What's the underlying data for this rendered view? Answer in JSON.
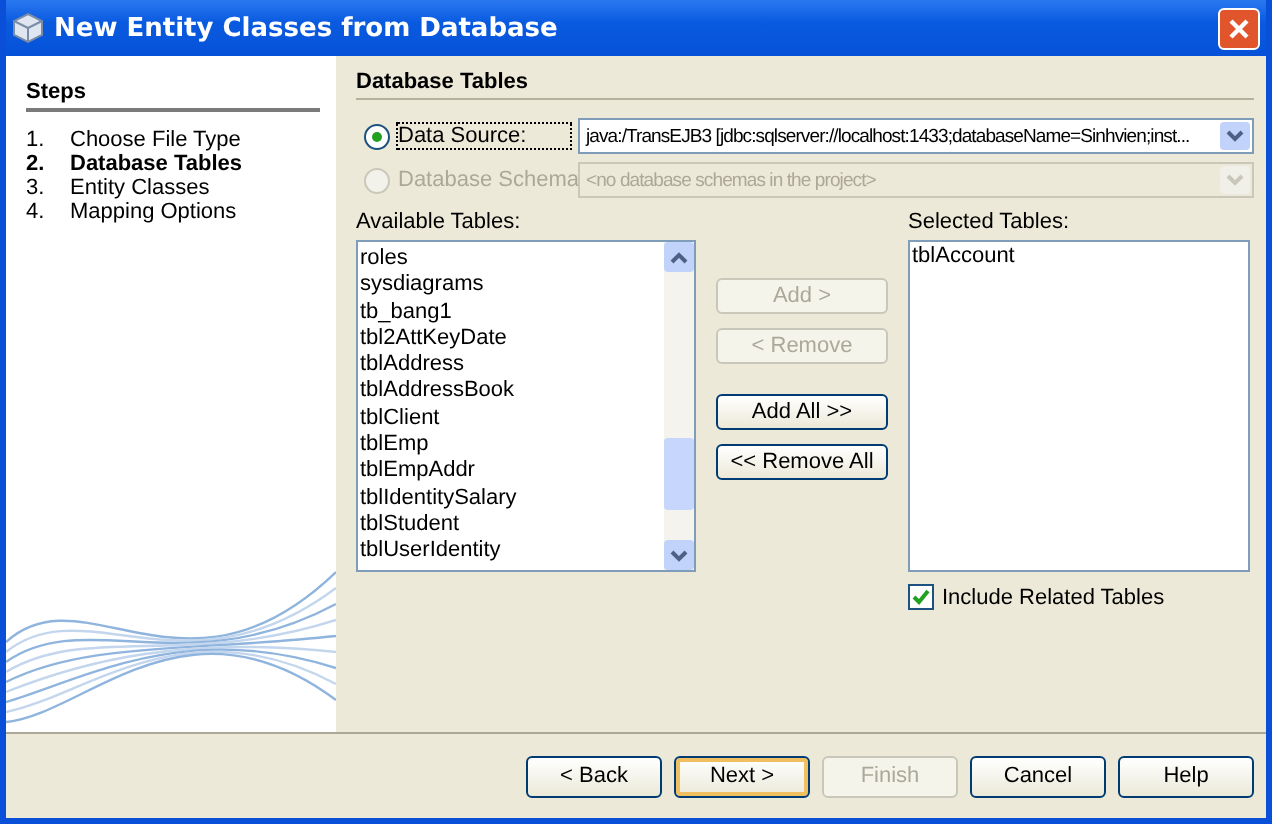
{
  "window": {
    "title": "New Entity Classes from Database"
  },
  "steps": {
    "title": "Steps",
    "items": [
      {
        "number": "1.",
        "label": "Choose File Type",
        "selected": false
      },
      {
        "number": "2.",
        "label": "Database Tables",
        "selected": true
      },
      {
        "number": "3.",
        "label": "Entity Classes",
        "selected": false
      },
      {
        "number": "4.",
        "label": "Mapping Options",
        "selected": false
      }
    ]
  },
  "panel": {
    "title": "Database Tables",
    "sources": [
      {
        "label": "Data Source:",
        "selected": true,
        "disabled": false,
        "value": "java:/TransEJB3 [jdbc:sqlserver://localhost:1433;databaseName=Sinhvien;inst..."
      },
      {
        "label": "Database Schema",
        "selected": false,
        "disabled": true,
        "value": "<no database schemas in the project>"
      }
    ],
    "available": {
      "label": "Available Tables:",
      "items": [
        "roles",
        "sysdiagrams",
        "tb_bang1",
        "tbl2AttKeyDate",
        "tblAddress",
        "tblAddressBook",
        "tblClient",
        "tblEmp",
        "tblEmpAddr",
        "tblIdentitySalary",
        "tblStudent",
        "tblUserIdentity"
      ]
    },
    "actions": [
      {
        "label": "Add >",
        "disabled": true
      },
      {
        "label": "< Remove",
        "disabled": true
      },
      {
        "label": "Add All >>",
        "disabled": false
      },
      {
        "label": "<< Remove All",
        "disabled": false
      }
    ],
    "selected": {
      "label": "Selected Tables:",
      "items": [
        "tblAccount"
      ]
    },
    "include_related": {
      "label": "Include Related Tables",
      "checked": true
    }
  },
  "footer": [
    {
      "label": "< Back",
      "disabled": false,
      "default": false
    },
    {
      "label": "Next >",
      "disabled": false,
      "default": true
    },
    {
      "label": "Finish",
      "disabled": true,
      "default": false
    },
    {
      "label": "Cancel",
      "disabled": false,
      "default": false
    },
    {
      "label": "Help",
      "disabled": false,
      "default": false
    }
  ]
}
